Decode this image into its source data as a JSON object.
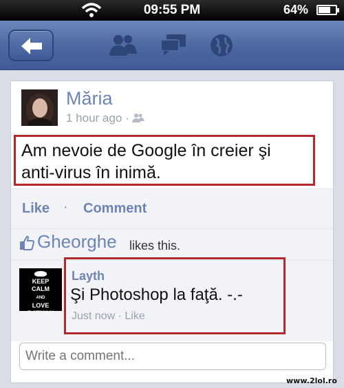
{
  "status_bar": {
    "time": "09:55 PM",
    "battery": "64%"
  },
  "nav": {
    "icons": [
      "back-arrow-icon",
      "friends-icon",
      "messages-icon",
      "globe-icon"
    ]
  },
  "post": {
    "author": "Măria",
    "meta": "1 hour ago ·",
    "text_line1": "Am nevoie de Google în creier şi",
    "text_line2": "anti-virus în inimă.",
    "actions": {
      "like": "Like",
      "separator": "·",
      "comment": "Comment"
    },
    "likes": {
      "name": "Gheorghe",
      "text": "likes this."
    }
  },
  "comment": {
    "avatar_text": "KEEP CALM AND LOVE BATMAN",
    "author": "Layth",
    "text": "Şi Photoshop la faţă. -.-",
    "time": "Just now ·",
    "like": "Like"
  },
  "comment_input": {
    "placeholder": "Write a comment..."
  },
  "watermark": "www.2lol.ro",
  "colors": {
    "link": "#6d84b4",
    "highlight_border": "#b3282d",
    "nav_bar": "#4f6aa3"
  }
}
